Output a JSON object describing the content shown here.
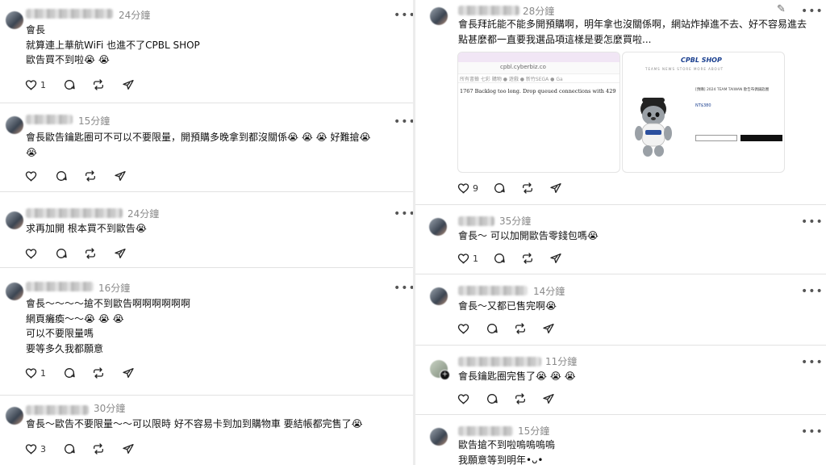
{
  "left_posts": [
    {
      "time": "24分鐘",
      "lines": [
        "會長",
        "就算連上華航WiFi 也進不了CPBL SHOP",
        "歐告買不到啦😭 😭"
      ],
      "like_count": "1",
      "icons": [
        "heart-icon",
        "comment-icon",
        "repost-icon",
        "share-icon"
      ]
    },
    {
      "time": "15分鐘",
      "lines": [
        "會長歐告鑰匙圈可不可以不要限量，開預購多晚拿到都沒關係😭 😭 😭  好難搶😭",
        "😭"
      ],
      "like_count": ""
    },
    {
      "time": "24分鐘",
      "lines": [
        "求再加開 根本買不到歐告😭"
      ],
      "like_count": ""
    },
    {
      "time": "16分鐘",
      "lines": [
        "會長～～～～搶不到歐告啊啊啊啊啊啊",
        "網頁癱瘓～～😭 😭 😭",
        "可以不要限量嗎",
        "要等多久我都願意"
      ],
      "like_count": "1"
    },
    {
      "time": "30分鐘",
      "lines": [
        "會長～歐告不要限量～～可以限時 好不容易卡到加到購物車 要結帳都完售了😭"
      ],
      "like_count": "3"
    }
  ],
  "right_posts": [
    {
      "time": "28分鐘",
      "lines": [
        "會長拜託能不能多開預購啊，明年拿也沒關係啊，網站炸掉進不去、好不容易進去",
        "點甚麼都一直要我選品項這樣是要怎麼買啦..."
      ],
      "like_count": "9",
      "attachment_browser": {
        "url": "cpbl.cyberbiz.co",
        "bookmarks": "所有書籤   七彩   購物   ●   遊戲   ● 新竹SEGA   ● Ga",
        "error": "1767 Backlog too long. Drop queued connections with 429"
      },
      "attachment_shop": {
        "logo": "CPBL SHOP",
        "nav": "TEAMS   NEWS   STORE   MORE   ABOUT",
        "product_title": "[預購] 2024 TEAM TAIWAN 歐告布偶鑰匙圈",
        "price": "NT$380"
      }
    },
    {
      "time": "35分鐘",
      "lines": [
        "會長～ 可以加開歐告零錢包嗎😭"
      ],
      "like_count": "1"
    },
    {
      "time": "14分鐘",
      "lines": [
        "會長～又都已售完啊😭"
      ],
      "like_count": ""
    },
    {
      "time": "11分鐘",
      "lines": [
        "會長鑰匙圈完售了😭 😭 😭"
      ],
      "like_count": ""
    },
    {
      "time": "15分鐘",
      "lines": [
        "歐告搶不到啦嗚嗚嗚嗚",
        "我願意等到明年•ᴗ•"
      ],
      "like_count": ""
    }
  ],
  "ui": {
    "more_glyph": "•••",
    "follow_plus": "+",
    "edit_icon": "pencil-icon"
  }
}
